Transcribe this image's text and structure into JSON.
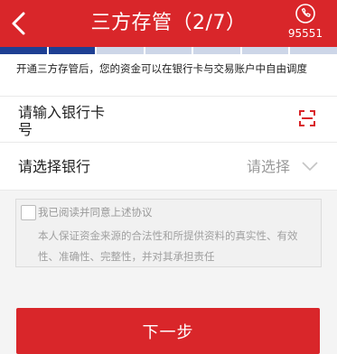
{
  "header": {
    "title": "三方存管（2/7）",
    "hotline": "95551",
    "icons": {
      "back": "chevron-left-icon",
      "hotline": "phone-service-icon"
    },
    "background": "#d9262a"
  },
  "progress": {
    "current_step": 2,
    "total_steps": 7,
    "done_color": "#1e3f93",
    "todo_color": "#cdd6e8"
  },
  "notice": "开通三方存管后，您的资金可以在银行卡与交易账户中自由调度",
  "form": {
    "card": {
      "label": "请输入银行卡号",
      "icon": "scan-icon"
    },
    "bank": {
      "label": "请选择银行",
      "value": "请选择",
      "icon": "chevron-down-icon"
    }
  },
  "agreement": {
    "checked": false,
    "label": "我已阅读并同意上述协议",
    "text": "本人保证资金来源的合法性和所提供资料的真实性、有效性、准确性、完整性，并对其承担责任"
  },
  "next_button": {
    "label": "下一步"
  }
}
